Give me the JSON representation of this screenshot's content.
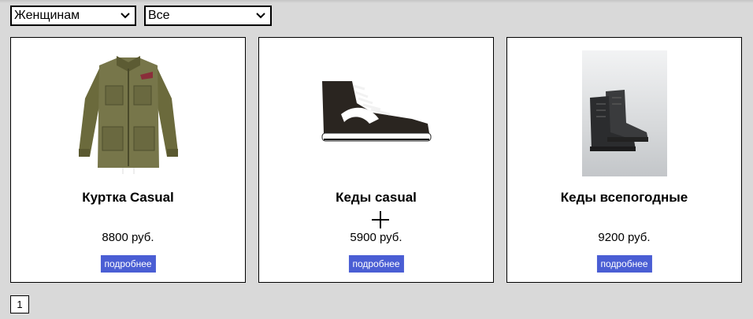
{
  "filters": {
    "gender": {
      "selected": "Женщинам"
    },
    "category": {
      "selected": "Все"
    }
  },
  "products": [
    {
      "title": "Куртка Casual",
      "price": "8800 руб.",
      "more_label": "подробнее",
      "image": "jacket-image"
    },
    {
      "title": "Кеды casual",
      "price": "5900 руб.",
      "more_label": "подробнее",
      "image": "sneaker-image"
    },
    {
      "title": "Кеды всепогодные",
      "price": "9200 руб.",
      "more_label": "подробнее",
      "image": "boots-image"
    }
  ],
  "pagination": {
    "current_page": "1"
  },
  "colors": {
    "background": "#d9d9d9",
    "button": "#4a5ed4"
  }
}
